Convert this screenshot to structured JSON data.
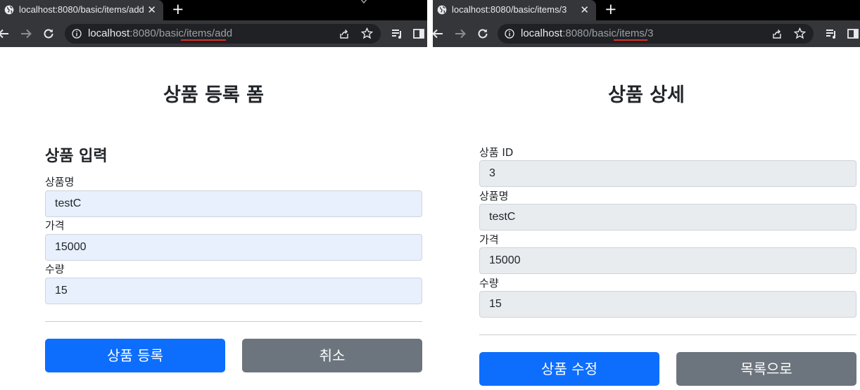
{
  "windows": [
    {
      "tab": {
        "title": "localhost:8080/basic/items/add"
      },
      "address": {
        "host": "localhost",
        "rest": ":8080/basic/items/add"
      },
      "page": {
        "title": "상품 등록 폼",
        "section_title": "상품 입력",
        "fields": [
          {
            "label": "상품명",
            "value": "testC"
          },
          {
            "label": "가격",
            "value": "15000"
          },
          {
            "label": "수량",
            "value": "15"
          }
        ],
        "buttons": {
          "primary": "상품 등록",
          "secondary": "취소"
        }
      }
    },
    {
      "tab": {
        "title": "localhost:8080/basic/items/3"
      },
      "address": {
        "host": "localhost",
        "rest": ":8080/basic/items/3"
      },
      "page": {
        "title": "상품 상세",
        "fields": [
          {
            "label": "상품 ID",
            "value": "3"
          },
          {
            "label": "상품명",
            "value": "testC"
          },
          {
            "label": "가격",
            "value": "15000"
          },
          {
            "label": "수량",
            "value": "15"
          }
        ],
        "buttons": {
          "primary": "상품 수정",
          "secondary": "목록으로"
        }
      }
    }
  ],
  "icons": {
    "tab_favicon": "globe-icon",
    "tab_close": "close-icon",
    "new_tab": "plus-icon",
    "tab_search": "chevron-down-icon",
    "back": "arrow-left-icon",
    "forward": "arrow-right-icon",
    "reload": "reload-icon",
    "site_info": "info-icon",
    "share": "share-icon",
    "bookmark": "star-icon",
    "reading_list": "reading-list-icon",
    "side_panel": "side-panel-icon"
  },
  "colors": {
    "primary_button": "#0d6efd",
    "secondary_button": "#6c757d",
    "autofill_bg": "#e8f0fe",
    "readonly_bg": "#e9ecef",
    "url_underline": "#d93025"
  }
}
